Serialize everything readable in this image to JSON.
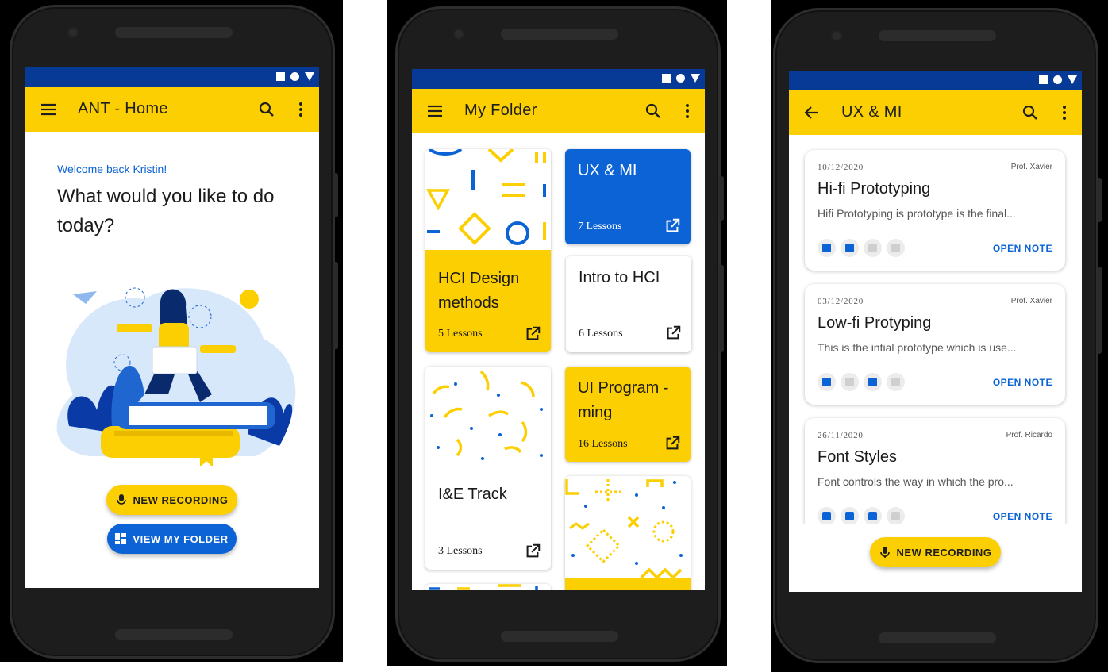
{
  "colors": {
    "yellow": "#fccf02",
    "blue": "#0b63d6",
    "status_bar": "#063a96"
  },
  "home": {
    "title": "ANT - Home",
    "welcome": "Welcome back Kristin!",
    "question": "What would you like to do today?",
    "new_recording": "NEW RECORDING",
    "view_folder": "VIEW MY FOLDER"
  },
  "folder": {
    "title": "My Folder",
    "cards": [
      {
        "title": "HCI Design methods",
        "lessons": "5 Lessons"
      },
      {
        "title": "UX & MI",
        "lessons": "7 Lessons"
      },
      {
        "title": "Intro to HCI",
        "lessons": "6 Lessons"
      },
      {
        "title": "I&E Track",
        "lessons": "3 Lessons"
      },
      {
        "title": "UI Program -ming",
        "lessons": "16 Lessons"
      }
    ]
  },
  "notes_screen": {
    "title": "UX & MI",
    "open_label": "OPEN NOTE",
    "new_recording": "NEW RECORDING",
    "notes": [
      {
        "date": "10/12/2020",
        "prof": "Prof. Xavier",
        "title": "Hi-fi Prototyping",
        "preview": "Hifi Prototyping is prototype is the final..."
      },
      {
        "date": "03/12/2020",
        "prof": "Prof. Xavier",
        "title": "Low-fi Protyping",
        "preview": "This is the intial prototype which is use..."
      },
      {
        "date": "26/11/2020",
        "prof": "Prof. Ricardo",
        "title": "Font Styles",
        "preview": "Font controls the way in which the pro..."
      }
    ]
  }
}
